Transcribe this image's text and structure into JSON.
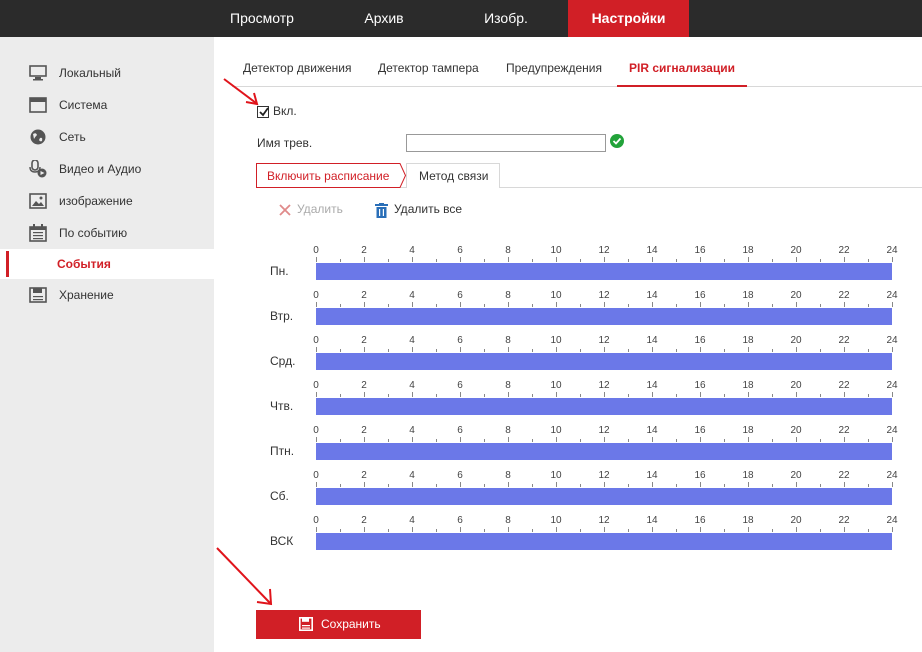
{
  "topnav": {
    "items": [
      {
        "label": "Просмотр",
        "active": false
      },
      {
        "label": "Архив",
        "active": false
      },
      {
        "label": "Изобр.",
        "active": false
      },
      {
        "label": "Настройки",
        "active": true
      }
    ]
  },
  "sidebar": {
    "items": [
      {
        "label": "Локальный",
        "icon": "monitor-icon"
      },
      {
        "label": "Система",
        "icon": "window-icon"
      },
      {
        "label": "Сеть",
        "icon": "globe-icon"
      },
      {
        "label": "Видео и Аудио",
        "icon": "mic-camera-icon"
      },
      {
        "label": "изображение",
        "icon": "image-icon"
      },
      {
        "label": "По событию",
        "icon": "calendar-icon"
      },
      {
        "label": "Хранение",
        "icon": "floppy-icon"
      }
    ],
    "active_sub": "События"
  },
  "subtabs": [
    {
      "label": "Детектор движения",
      "active": false
    },
    {
      "label": "Детектор тампера",
      "active": false
    },
    {
      "label": "Предупреждения",
      "active": false
    },
    {
      "label": "PIR сигнализации",
      "active": true
    }
  ],
  "form": {
    "enable_label": "Вкл.",
    "enable_checked": true,
    "alarm_name_label": "Имя трев.",
    "alarm_name_value": ""
  },
  "schedule_tabs": {
    "schedule_label": "Включить расписание",
    "linkage_label": "Метод связи"
  },
  "actions": {
    "delete_label": "Удалить",
    "delete_all_label": "Удалить все"
  },
  "schedule": {
    "hour_labels": [
      "0",
      "2",
      "4",
      "6",
      "8",
      "10",
      "12",
      "14",
      "16",
      "18",
      "20",
      "22",
      "24"
    ],
    "days": [
      {
        "label": "Пн.",
        "start": 0,
        "end": 24
      },
      {
        "label": "Втр.",
        "start": 0,
        "end": 24
      },
      {
        "label": "Срд.",
        "start": 0,
        "end": 24
      },
      {
        "label": "Чтв.",
        "start": 0,
        "end": 24
      },
      {
        "label": "Птн.",
        "start": 0,
        "end": 24
      },
      {
        "label": "Сб.",
        "start": 0,
        "end": 24
      },
      {
        "label": "ВСК",
        "start": 0,
        "end": 24
      }
    ],
    "bar_color": "#6b78e8"
  },
  "save_label": "Сохранить",
  "colors": {
    "accent": "#d11f26",
    "topbar": "#2b2b2b",
    "sidebar": "#ececec",
    "ok": "#22a33a"
  }
}
